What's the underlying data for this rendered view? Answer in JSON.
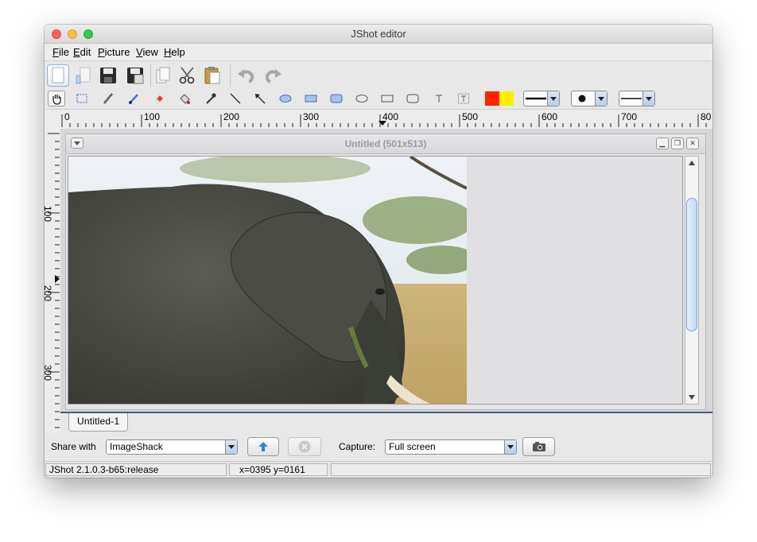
{
  "window": {
    "title": "JShot editor"
  },
  "menu": [
    {
      "key": "F",
      "rest": "ile"
    },
    {
      "key": "E",
      "rest": "dit"
    },
    {
      "key": "P",
      "rest": "icture"
    },
    {
      "key": "V",
      "rest": "iew"
    },
    {
      "key": "H",
      "rest": "elp"
    }
  ],
  "ruler": {
    "h_labels": [
      "0",
      "100",
      "200",
      "300",
      "400",
      "500",
      "600",
      "700",
      "80"
    ],
    "v_labels": [
      "100",
      "200",
      "300"
    ]
  },
  "document": {
    "title": "Untitled (501x513)",
    "tab": "Untitled-1"
  },
  "share": {
    "label": "Share with",
    "service": "ImageShack",
    "capture_label": "Capture:",
    "capture_mode": "Full screen"
  },
  "status": {
    "version": "JShot 2.1.0.3-b65:release",
    "coords": "x=0395 y=0161"
  },
  "colors": {
    "foreground": "#ff2200",
    "background": "#ffee00",
    "accent": "#7aa4d8"
  }
}
